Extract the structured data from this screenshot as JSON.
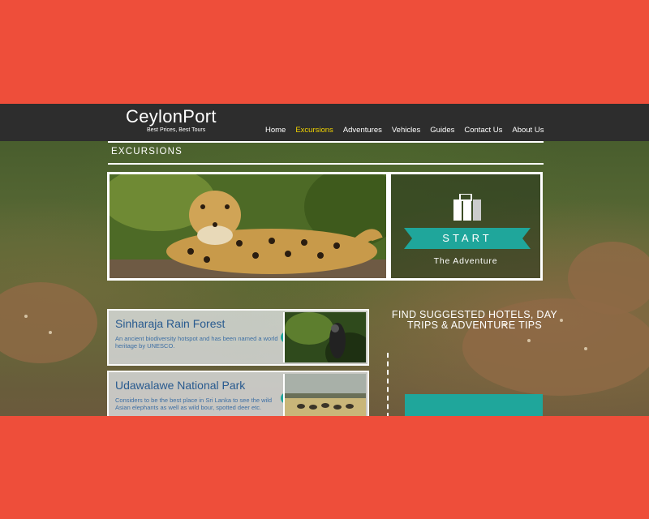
{
  "colors": {
    "frame": "#ee4e3a",
    "header": "#2d2d2d",
    "accent_teal": "#1fa69b",
    "nav_active": "#f1d300",
    "card_title": "#285a8f"
  },
  "brand": {
    "name": "CeylonPort",
    "tagline": "Best Prices, Best Tours"
  },
  "nav": {
    "items": [
      "Home",
      "Excursions",
      "Adventures",
      "Vehicles",
      "Guides",
      "Contact Us",
      "About Us"
    ],
    "active": "Excursions"
  },
  "section": {
    "title": "EXCURSIONS"
  },
  "hero": {
    "image": "leopard-photo"
  },
  "start_panel": {
    "icon": "suitcase-icon",
    "button": "START",
    "subtitle": "The Adventure"
  },
  "cards": [
    {
      "title": "Sinharaja Rain Forest",
      "description": "An ancient biodiversity hotspot and has been named a world heritage by UNESCO.",
      "image": "rainforest-bird-photo"
    },
    {
      "title": "Udawalawe National Park",
      "description": "Considers to be the best place in Sri Lanka to see the wild Asian elephants as well as wild bour, spotted deer etc.",
      "image": "elephants-savanna-photo"
    }
  ],
  "find": {
    "text": "FIND SUGGESTED HOTELS, DAY TRIPS & ADVENTURE TIPS"
  }
}
